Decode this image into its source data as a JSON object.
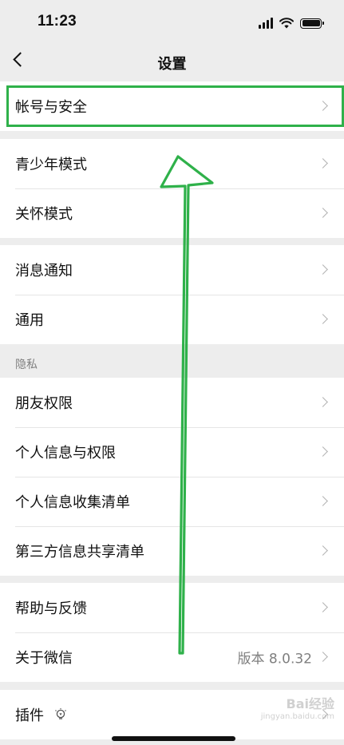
{
  "status_bar": {
    "time": "11:23"
  },
  "nav": {
    "title": "设置"
  },
  "groups": {
    "account": {
      "items": [
        {
          "label": "帐号与安全"
        }
      ]
    },
    "modes": {
      "items": [
        {
          "label": "青少年模式"
        },
        {
          "label": "关怀模式"
        }
      ]
    },
    "general": {
      "items": [
        {
          "label": "消息通知"
        },
        {
          "label": "通用"
        }
      ]
    },
    "privacy": {
      "header": "隐私",
      "items": [
        {
          "label": "朋友权限"
        },
        {
          "label": "个人信息与权限"
        },
        {
          "label": "个人信息收集清单"
        },
        {
          "label": "第三方信息共享清单"
        }
      ]
    },
    "about": {
      "items": [
        {
          "label": "帮助与反馈"
        },
        {
          "label": "关于微信",
          "value": "版本 8.0.32"
        }
      ]
    },
    "plugins": {
      "items": [
        {
          "label": "插件"
        }
      ]
    }
  },
  "annotation_color": "#2fb14a",
  "watermark": {
    "text": "Bai经验",
    "url": "jingyan.baidu.com"
  }
}
